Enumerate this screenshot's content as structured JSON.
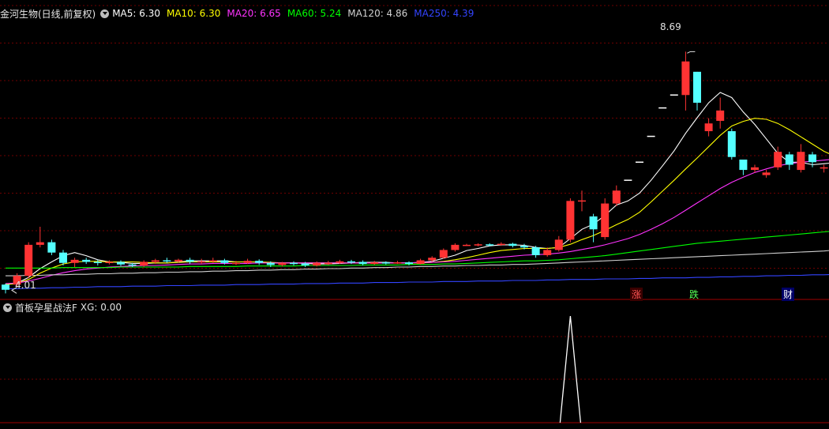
{
  "header": {
    "title": "金河生物(日线,前复权)",
    "ma": [
      {
        "label": "MA5: 6.30",
        "color": "#ffffff"
      },
      {
        "label": "MA10: 6.30",
        "color": "#ffff00"
      },
      {
        "label": "MA20: 6.65",
        "color": "#ff33ff"
      },
      {
        "label": "MA60: 5.24",
        "color": "#00ff00"
      },
      {
        "label": "MA120: 4.86",
        "color": "#d0d0d0"
      },
      {
        "label": "MA250: 4.39",
        "color": "#3344ff"
      }
    ]
  },
  "indicator": {
    "name": "首板孕星战法F",
    "xg_label": "XG: 0.00"
  },
  "markers": {
    "rise": "涨",
    "fall": "跌",
    "wealth": "财"
  },
  "colors": {
    "up": "#ff3333",
    "down": "#54ffff",
    "grid": "#6e0000",
    "axis": "#a00000"
  },
  "chart_data": {
    "type": "candlestick",
    "price_range": [
      4.0,
      9.2
    ],
    "annotations": {
      "high": "8.69",
      "low": "4.01"
    },
    "candles": [
      [
        4.18,
        4.08,
        4.2,
        4.01
      ],
      [
        4.18,
        4.35,
        4.4,
        4.15
      ],
      [
        4.35,
        4.95,
        5.0,
        4.3
      ],
      [
        4.95,
        5.0,
        5.3,
        4.9
      ],
      [
        5.0,
        4.8,
        5.05,
        4.75
      ],
      [
        4.8,
        4.6,
        4.85,
        4.55
      ],
      [
        4.6,
        4.66,
        4.7,
        4.52
      ],
      [
        4.66,
        4.62,
        4.7,
        4.58
      ],
      [
        4.62,
        4.6,
        4.66,
        4.55
      ],
      [
        4.6,
        4.62,
        4.65,
        4.57
      ],
      [
        4.62,
        4.57,
        4.65,
        4.54
      ],
      [
        4.57,
        4.55,
        4.6,
        4.52
      ],
      [
        4.55,
        4.62,
        4.65,
        4.52
      ],
      [
        4.62,
        4.65,
        4.68,
        4.58
      ],
      [
        4.65,
        4.63,
        4.7,
        4.6
      ],
      [
        4.63,
        4.66,
        4.68,
        4.6
      ],
      [
        4.66,
        4.62,
        4.7,
        4.58
      ],
      [
        4.62,
        4.63,
        4.68,
        4.58
      ],
      [
        4.63,
        4.65,
        4.7,
        4.6
      ],
      [
        4.65,
        4.6,
        4.68,
        4.57
      ],
      [
        4.6,
        4.6,
        4.64,
        4.56
      ],
      [
        4.6,
        4.64,
        4.68,
        4.58
      ],
      [
        4.64,
        4.6,
        4.67,
        4.56
      ],
      [
        4.6,
        4.56,
        4.63,
        4.52
      ],
      [
        4.56,
        4.6,
        4.62,
        4.53
      ],
      [
        4.6,
        4.59,
        4.63,
        4.55
      ],
      [
        4.59,
        4.55,
        4.62,
        4.52
      ],
      [
        4.55,
        4.6,
        4.63,
        4.53
      ],
      [
        4.6,
        4.6,
        4.64,
        4.56
      ],
      [
        4.6,
        4.63,
        4.66,
        4.58
      ],
      [
        4.63,
        4.62,
        4.66,
        4.58
      ],
      [
        4.62,
        4.58,
        4.65,
        4.55
      ],
      [
        4.58,
        4.61,
        4.64,
        4.56
      ],
      [
        4.61,
        4.6,
        4.63,
        4.57
      ],
      [
        4.6,
        4.61,
        4.64,
        4.58
      ],
      [
        4.61,
        4.58,
        4.63,
        4.55
      ],
      [
        4.58,
        4.65,
        4.68,
        4.57
      ],
      [
        4.65,
        4.7,
        4.73,
        4.62
      ],
      [
        4.7,
        4.85,
        4.88,
        4.68
      ],
      [
        4.85,
        4.95,
        4.98,
        4.82
      ],
      [
        4.95,
        4.95,
        4.97,
        4.93
      ],
      [
        4.95,
        4.96,
        4.98,
        4.92
      ],
      [
        4.96,
        4.95,
        4.98,
        4.92
      ],
      [
        4.95,
        4.97,
        5.0,
        4.93
      ],
      [
        4.97,
        4.93,
        4.99,
        4.9
      ],
      [
        4.93,
        4.9,
        4.97,
        4.86
      ],
      [
        4.9,
        4.75,
        4.93,
        4.7
      ],
      [
        4.75,
        4.85,
        4.9,
        4.72
      ],
      [
        4.85,
        5.05,
        5.12,
        4.82
      ],
      [
        5.05,
        5.8,
        5.85,
        5.0
      ],
      [
        5.8,
        5.81,
        6.0,
        5.6
      ],
      [
        5.5,
        5.25,
        5.55,
        5.0
      ],
      [
        5.1,
        5.75,
        5.85,
        5.05
      ],
      [
        5.75,
        6.0,
        6.1,
        5.7
      ],
      [
        6.2,
        6.2,
        6.2,
        6.2
      ],
      [
        6.55,
        6.55,
        6.55,
        6.55
      ],
      [
        7.05,
        7.05,
        7.05,
        7.05
      ],
      [
        7.6,
        7.6,
        7.6,
        7.6
      ],
      [
        7.85,
        7.85,
        7.85,
        7.85
      ],
      [
        7.85,
        8.5,
        8.69,
        7.55
      ],
      [
        8.3,
        7.7,
        8.3,
        7.55
      ],
      [
        7.15,
        7.3,
        7.4,
        7.05
      ],
      [
        7.35,
        7.55,
        7.8,
        7.2
      ],
      [
        7.15,
        6.65,
        7.2,
        6.6
      ],
      [
        6.6,
        6.4,
        6.6,
        6.3
      ],
      [
        6.4,
        6.45,
        6.5,
        6.35
      ],
      [
        6.3,
        6.35,
        6.4,
        6.25
      ],
      [
        6.45,
        6.75,
        6.85,
        6.4
      ],
      [
        6.7,
        6.5,
        6.75,
        6.4
      ],
      [
        6.4,
        6.75,
        6.9,
        6.35
      ],
      [
        6.7,
        6.55,
        6.75,
        6.45
      ],
      [
        6.45,
        6.45,
        6.5,
        6.35
      ],
      [
        6.65,
        6.45,
        6.7,
        6.35
      ],
      [
        6.6,
        6.35,
        6.7,
        6.3
      ]
    ],
    "series": [
      {
        "name": "MA5",
        "values": [
          4.18,
          4.21,
          4.32,
          4.49,
          4.62,
          4.74,
          4.8,
          4.74,
          4.66,
          4.62,
          4.61,
          4.59,
          4.59,
          4.6,
          4.6,
          4.62,
          4.64,
          4.64,
          4.64,
          4.64,
          4.62,
          4.62,
          4.62,
          4.6,
          4.6,
          4.6,
          4.59,
          4.58,
          4.58,
          4.59,
          4.6,
          4.61,
          4.61,
          4.61,
          4.6,
          4.6,
          4.61,
          4.63,
          4.69,
          4.75,
          4.84,
          4.88,
          4.93,
          4.95,
          4.95,
          4.94,
          4.9,
          4.88,
          4.9,
          5.07,
          5.25,
          5.35,
          5.52,
          5.72,
          5.8,
          5.95,
          6.2,
          6.48,
          6.77,
          7.11,
          7.41,
          7.7,
          7.9,
          7.8,
          7.52,
          7.28,
          7.0,
          6.72,
          6.55,
          6.55,
          6.5,
          6.52,
          6.54,
          6.45
        ]
      },
      {
        "name": "MA10",
        "values": [
          4.18,
          4.2,
          4.28,
          4.4,
          4.5,
          4.58,
          4.62,
          4.63,
          4.63,
          4.62,
          4.62,
          4.62,
          4.61,
          4.6,
          4.6,
          4.61,
          4.62,
          4.62,
          4.62,
          4.62,
          4.62,
          4.62,
          4.62,
          4.61,
          4.6,
          4.6,
          4.6,
          4.6,
          4.6,
          4.6,
          4.6,
          4.6,
          4.6,
          4.6,
          4.6,
          4.6,
          4.6,
          4.61,
          4.63,
          4.66,
          4.7,
          4.75,
          4.8,
          4.84,
          4.86,
          4.88,
          4.88,
          4.88,
          4.9,
          4.96,
          5.05,
          5.13,
          5.23,
          5.34,
          5.44,
          5.58,
          5.78,
          5.99,
          6.2,
          6.42,
          6.63,
          6.85,
          7.07,
          7.25,
          7.34,
          7.4,
          7.38,
          7.3,
          7.18,
          7.04,
          6.9,
          6.76,
          6.66,
          6.58
        ]
      },
      {
        "name": "MA20",
        "values": [
          4.2,
          4.21,
          4.25,
          4.3,
          4.36,
          4.41,
          4.45,
          4.48,
          4.5,
          4.52,
          4.53,
          4.54,
          4.55,
          4.55,
          4.56,
          4.57,
          4.58,
          4.58,
          4.59,
          4.59,
          4.59,
          4.59,
          4.6,
          4.6,
          4.6,
          4.6,
          4.6,
          4.6,
          4.6,
          4.6,
          4.6,
          4.6,
          4.6,
          4.6,
          4.6,
          4.6,
          4.61,
          4.61,
          4.62,
          4.63,
          4.65,
          4.67,
          4.69,
          4.71,
          4.73,
          4.75,
          4.76,
          4.77,
          4.79,
          4.82,
          4.86,
          4.9,
          4.95,
          5.01,
          5.07,
          5.15,
          5.25,
          5.36,
          5.48,
          5.62,
          5.76,
          5.9,
          6.04,
          6.16,
          6.26,
          6.35,
          6.42,
          6.48,
          6.52,
          6.55,
          6.57,
          6.59,
          6.61,
          6.65
        ]
      },
      {
        "name": "MA60",
        "values": [
          4.5,
          4.5,
          4.5,
          4.5,
          4.5,
          4.51,
          4.51,
          4.51,
          4.51,
          4.51,
          4.52,
          4.52,
          4.52,
          4.52,
          4.52,
          4.52,
          4.53,
          4.53,
          4.53,
          4.53,
          4.53,
          4.54,
          4.54,
          4.54,
          4.54,
          4.54,
          4.55,
          4.55,
          4.55,
          4.55,
          4.55,
          4.56,
          4.56,
          4.56,
          4.56,
          4.57,
          4.57,
          4.57,
          4.58,
          4.58,
          4.59,
          4.6,
          4.61,
          4.62,
          4.63,
          4.64,
          4.64,
          4.65,
          4.66,
          4.68,
          4.7,
          4.72,
          4.74,
          4.77,
          4.8,
          4.83,
          4.86,
          4.89,
          4.92,
          4.95,
          4.98,
          5.0,
          5.02,
          5.04,
          5.06,
          5.08,
          5.1,
          5.12,
          5.14,
          5.16,
          5.18,
          5.2,
          5.22,
          5.24
        ]
      },
      {
        "name": "MA120",
        "values": [
          4.35,
          4.35,
          4.36,
          4.36,
          4.37,
          4.37,
          4.38,
          4.38,
          4.39,
          4.39,
          4.4,
          4.4,
          4.41,
          4.41,
          4.42,
          4.42,
          4.43,
          4.43,
          4.44,
          4.44,
          4.45,
          4.45,
          4.46,
          4.46,
          4.47,
          4.47,
          4.48,
          4.48,
          4.49,
          4.49,
          4.5,
          4.5,
          4.51,
          4.51,
          4.52,
          4.52,
          4.53,
          4.53,
          4.54,
          4.54,
          4.55,
          4.55,
          4.56,
          4.56,
          4.57,
          4.57,
          4.58,
          4.59,
          4.6,
          4.61,
          4.62,
          4.63,
          4.64,
          4.65,
          4.66,
          4.67,
          4.68,
          4.69,
          4.7,
          4.71,
          4.72,
          4.73,
          4.74,
          4.75,
          4.76,
          4.77,
          4.78,
          4.79,
          4.8,
          4.81,
          4.82,
          4.83,
          4.85,
          4.86
        ]
      },
      {
        "name": "MA250",
        "values": [
          4.1,
          4.1,
          4.11,
          4.11,
          4.12,
          4.12,
          4.13,
          4.13,
          4.14,
          4.14,
          4.14,
          4.15,
          4.15,
          4.15,
          4.16,
          4.16,
          4.16,
          4.17,
          4.17,
          4.17,
          4.18,
          4.18,
          4.18,
          4.19,
          4.19,
          4.19,
          4.2,
          4.2,
          4.2,
          4.21,
          4.21,
          4.21,
          4.22,
          4.22,
          4.22,
          4.23,
          4.23,
          4.23,
          4.24,
          4.24,
          4.24,
          4.25,
          4.25,
          4.25,
          4.26,
          4.26,
          4.26,
          4.27,
          4.27,
          4.28,
          4.28,
          4.28,
          4.29,
          4.29,
          4.29,
          4.3,
          4.3,
          4.31,
          4.31,
          4.31,
          4.32,
          4.32,
          4.33,
          4.33,
          4.34,
          4.34,
          4.35,
          4.35,
          4.36,
          4.36,
          4.37,
          4.37,
          4.38,
          4.39
        ]
      }
    ],
    "xg_signal": {
      "index": 49,
      "value": 1
    }
  }
}
